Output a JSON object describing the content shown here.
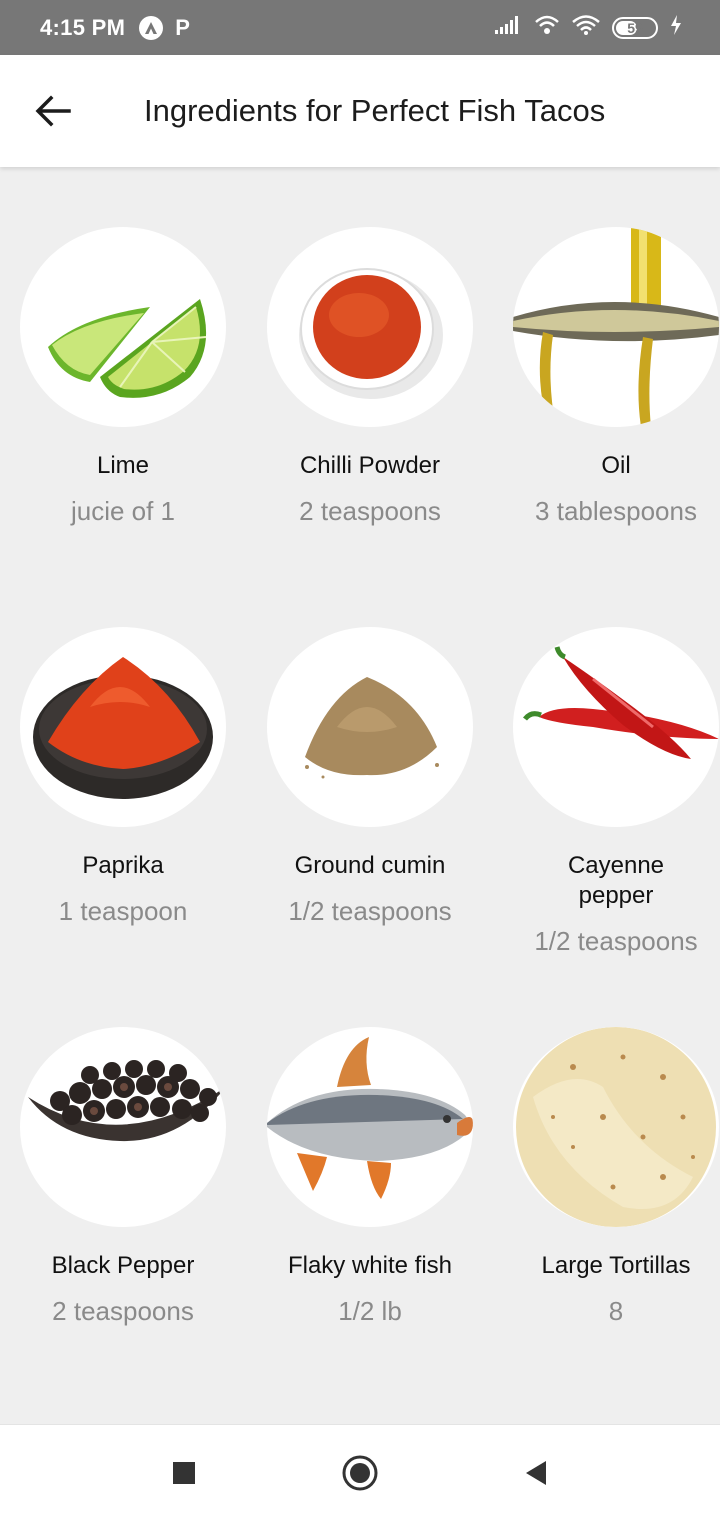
{
  "status_bar": {
    "time": "4:15 PM",
    "app_letter": "P",
    "battery": "59",
    "battery_level_percent": 59
  },
  "header": {
    "title": "Ingredients for Perfect Fish Tacos",
    "back_icon": "arrow-back-icon"
  },
  "ingredients": [
    {
      "name": "Lime",
      "quantity": "jucie of 1"
    },
    {
      "name": "Chilli Powder",
      "quantity": "2 teaspoons"
    },
    {
      "name": "Oil",
      "quantity": "3 tablespoons"
    },
    {
      "name": "Paprika",
      "quantity": "1 teaspoon"
    },
    {
      "name": "Ground cumin",
      "quantity": "1/2 teaspoons"
    },
    {
      "name": "Cayenne pepper",
      "quantity": "1/2 teaspoons"
    },
    {
      "name": "Black Pepper",
      "quantity": "2 teaspoons"
    },
    {
      "name": "Flaky white fish",
      "quantity": "1/2 lb"
    },
    {
      "name": "Large Tortillas",
      "quantity": "8"
    }
  ],
  "nav": {
    "recents_icon": "square-icon",
    "home_icon": "circle-icon",
    "back_icon": "triangle-back-icon"
  }
}
